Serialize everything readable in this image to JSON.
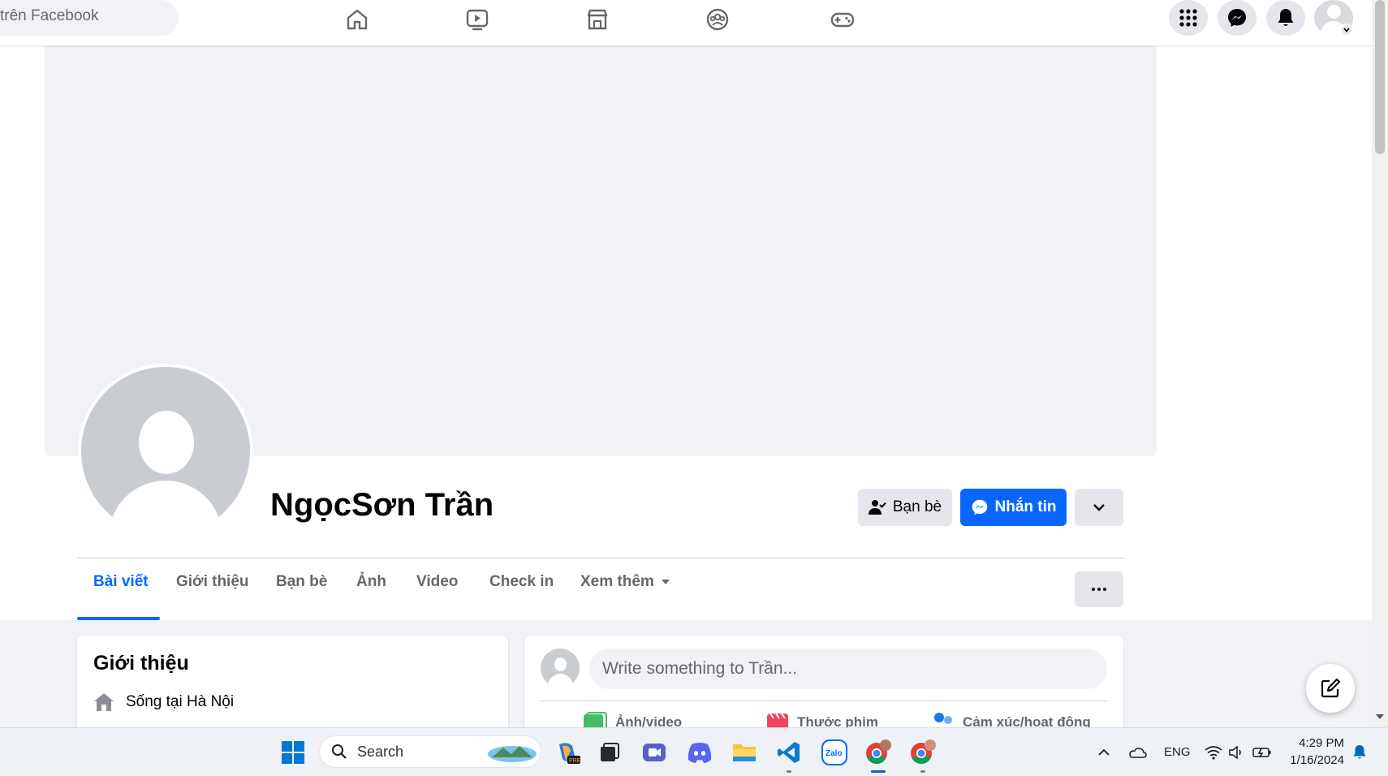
{
  "topbar": {
    "search_text": "trên Facebook",
    "nav_icons": [
      "home-icon",
      "watch-icon",
      "marketplace-icon",
      "groups-icon",
      "gaming-icon"
    ],
    "right_icons": [
      "menu-grid-icon",
      "messenger-icon",
      "notifications-icon"
    ]
  },
  "profile": {
    "name": "NgọcSơn Trần",
    "friends_button": "Bạn bè",
    "message_button": "Nhắn tin"
  },
  "tabs": [
    {
      "label": "Bài viết",
      "active": true
    },
    {
      "label": "Giới thiệu"
    },
    {
      "label": "Bạn bè"
    },
    {
      "label": "Ảnh"
    },
    {
      "label": "Video"
    },
    {
      "label": "Check in"
    },
    {
      "label": "Xem thêm"
    }
  ],
  "intro": {
    "title": "Giới thiệu",
    "lives_prefix": "Sống tại",
    "lives_city": "Hà Nội"
  },
  "composer": {
    "placeholder": "Write something to Trần...",
    "actions": [
      "Ảnh/video",
      "Thước phim",
      "Cảm xúc/hoạt động"
    ]
  },
  "taskbar": {
    "search_placeholder": "Search",
    "language": "ENG",
    "time": "4:29 PM",
    "date": "1/16/2024"
  },
  "colors": {
    "brand_blue": "#0866ff",
    "page_bg": "#f0f2f5",
    "button_grey": "#e4e6eb",
    "text_secondary": "#65676b"
  }
}
